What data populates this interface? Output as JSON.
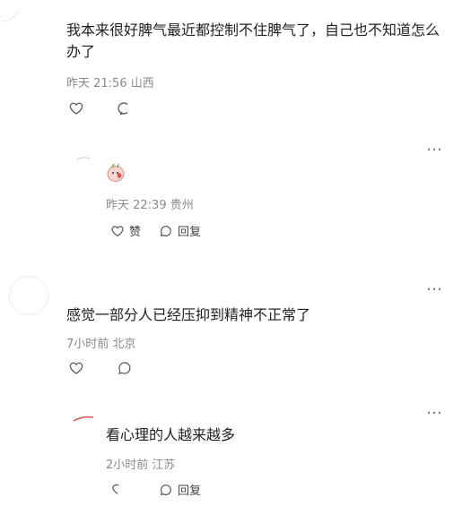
{
  "comments": [
    {
      "text": "我本来很好脾气最近都控制不住脾气了，自己也不知道怎么办了",
      "meta": "昨天 21:56 山西"
    },
    {
      "meta": "昨天 22:39 贵州",
      "like_label": "赞",
      "reply_label": "回复"
    },
    {
      "text": "感觉一部分人已经压抑到精神不正常了",
      "meta": "7小时前 北京"
    },
    {
      "text": "看心理的人越来越多",
      "meta": "2小时前 江苏",
      "reply_label": "回复"
    }
  ],
  "more_label": "…",
  "colors": {
    "accent_red": "#d9534f",
    "meta_gray": "#8a8a8a"
  }
}
